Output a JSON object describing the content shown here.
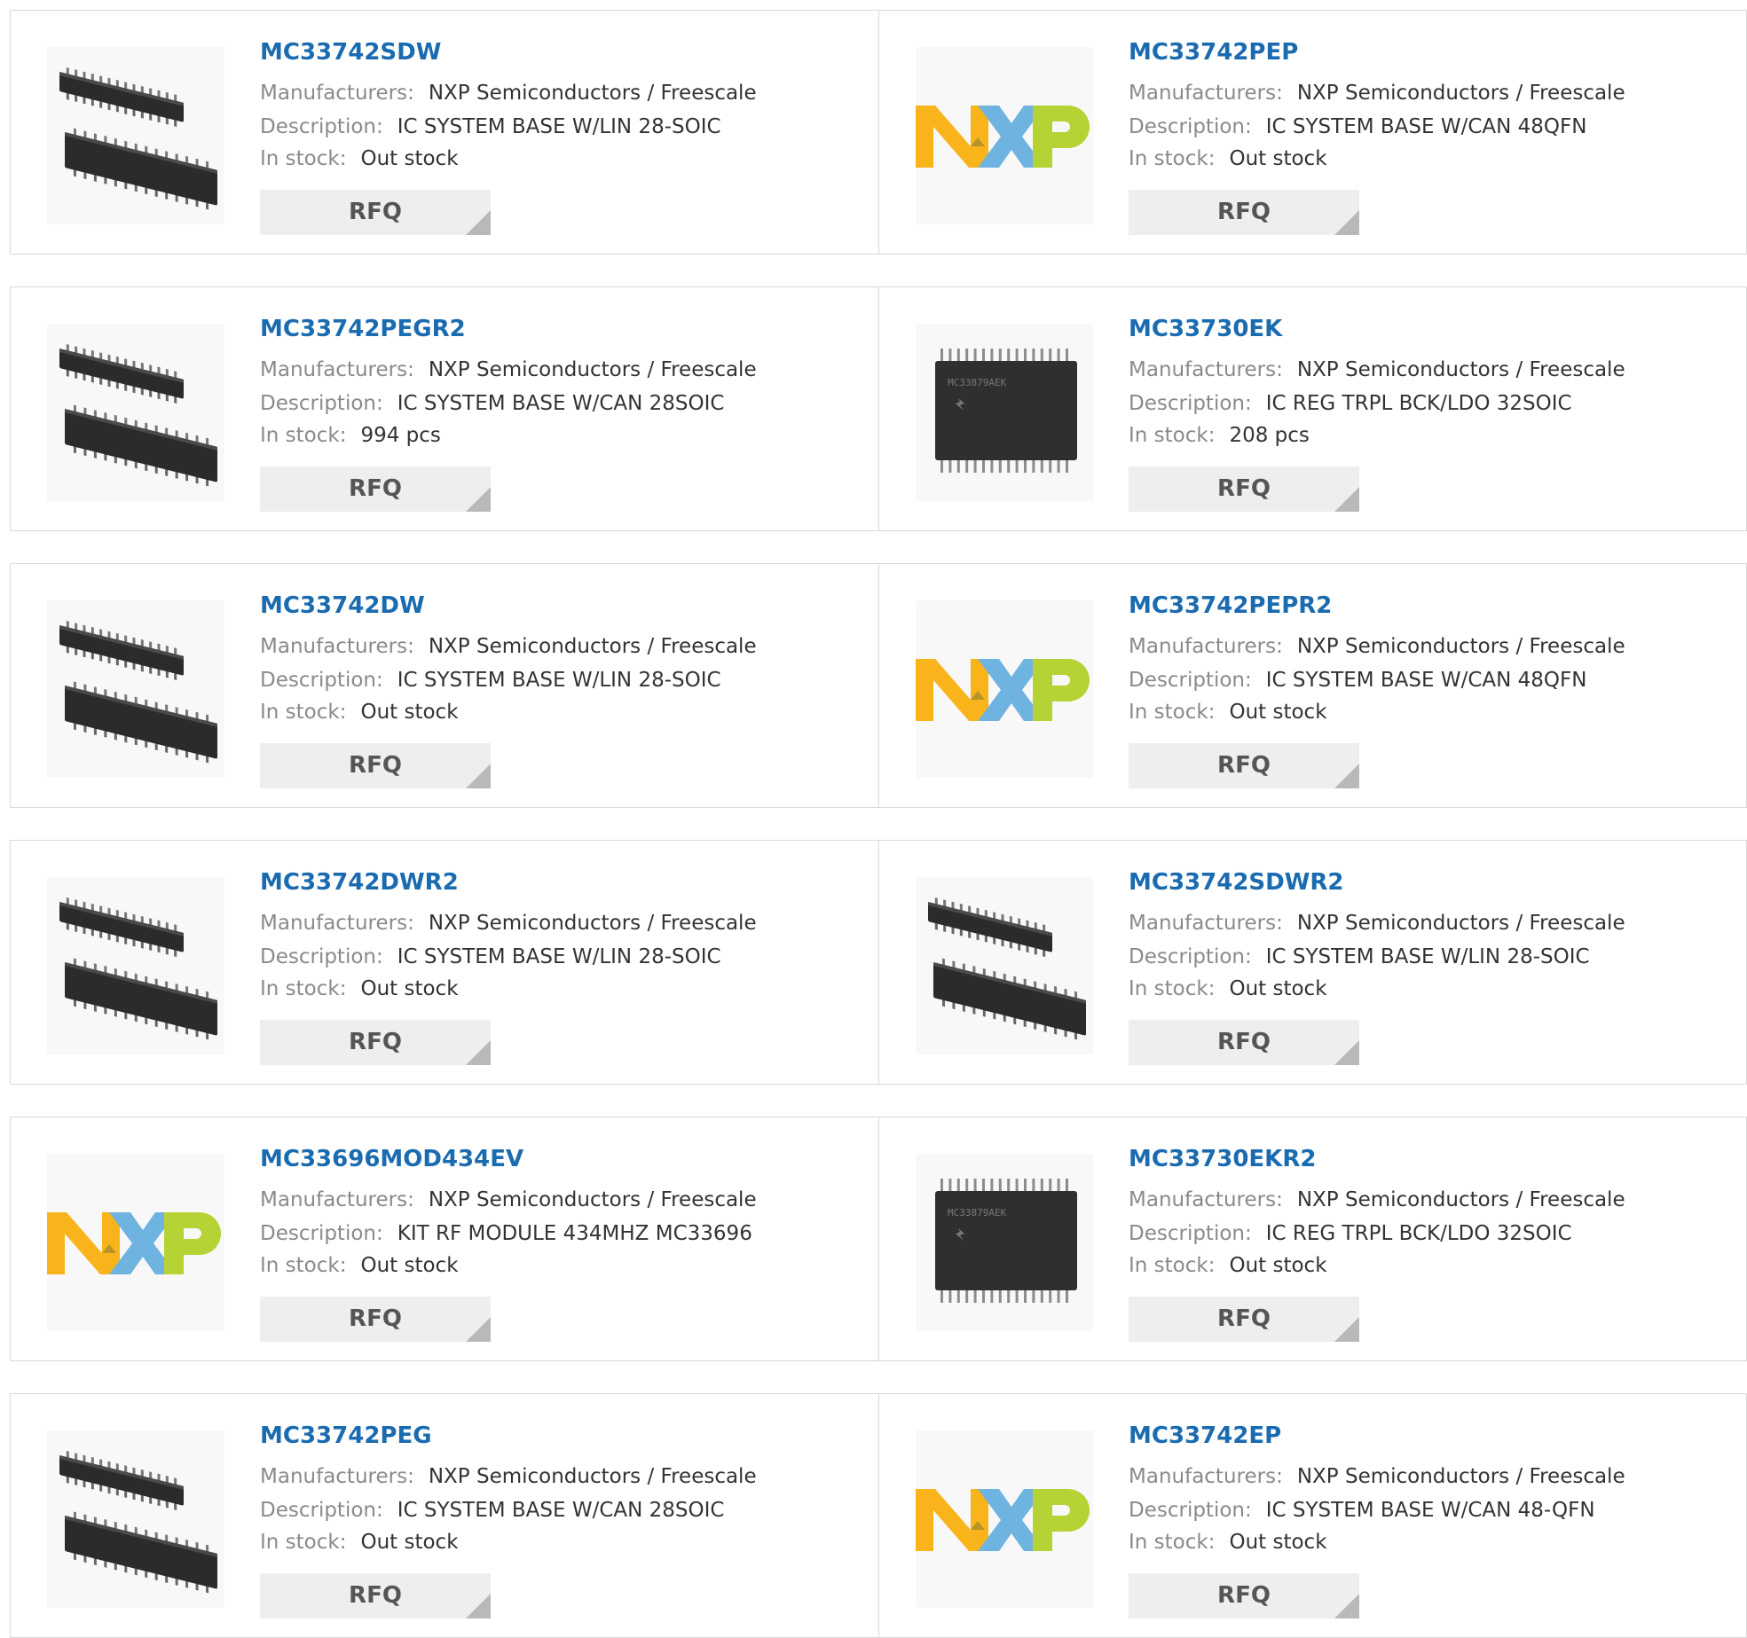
{
  "labels": {
    "manufacturers": "Manufacturers:",
    "description": "Description:",
    "in_stock": "In stock:",
    "rfq": "RFQ"
  },
  "colors": {
    "part_link": "#1a6bb0",
    "rfq_bg": "#eeeeee",
    "border": "#d9d9d9",
    "nxp_orange": "#f9b41b",
    "nxp_blue": "#6fb3e0",
    "nxp_green": "#b5d334"
  },
  "rows": [
    [
      {
        "part": "MC33742SDW",
        "image": "soic-package-pair-icon",
        "manufacturer": "NXP Semiconductors / Freescale",
        "description": "IC SYSTEM BASE W/LIN 28-SOIC",
        "stock": "Out stock"
      },
      {
        "part": "MC33742PEP",
        "image": "nxp-logo-icon",
        "manufacturer": "NXP Semiconductors / Freescale",
        "description": "IC SYSTEM BASE W/CAN 48QFN",
        "stock": "Out stock"
      }
    ],
    [
      {
        "part": "MC33742PEGR2",
        "image": "soic-package-pair-icon",
        "manufacturer": "NXP Semiconductors / Freescale",
        "description": "IC SYSTEM BASE W/CAN 28SOIC",
        "stock": "994 pcs"
      },
      {
        "part": "MC33730EK",
        "image": "chip-top-view-icon",
        "chip_marking": "MC33879AEK",
        "manufacturer": "NXP Semiconductors / Freescale",
        "description": "IC REG TRPL BCK/LDO 32SOIC",
        "stock": "208 pcs"
      }
    ],
    [
      {
        "part": "MC33742DW",
        "image": "soic-package-pair-icon",
        "manufacturer": "NXP Semiconductors / Freescale",
        "description": "IC SYSTEM BASE W/LIN 28-SOIC",
        "stock": "Out stock"
      },
      {
        "part": "MC33742PEPR2",
        "image": "nxp-logo-icon",
        "manufacturer": "NXP Semiconductors / Freescale",
        "description": "IC SYSTEM BASE W/CAN 48QFN",
        "stock": "Out stock"
      }
    ],
    [
      {
        "part": "MC33742DWR2",
        "image": "soic-package-pair-icon",
        "manufacturer": "NXP Semiconductors / Freescale",
        "description": "IC SYSTEM BASE W/LIN 28-SOIC",
        "stock": "Out stock"
      },
      {
        "part": "MC33742SDWR2",
        "image": "soic-package-pair-icon",
        "manufacturer": "NXP Semiconductors / Freescale",
        "description": "IC SYSTEM BASE W/LIN 28-SOIC",
        "stock": "Out stock"
      }
    ],
    [
      {
        "part": "MC33696MOD434EV",
        "image": "nxp-logo-icon",
        "manufacturer": "NXP Semiconductors / Freescale",
        "description": "KIT RF MODULE 434MHZ MC33696",
        "stock": "Out stock"
      },
      {
        "part": "MC33730EKR2",
        "image": "chip-top-view-icon",
        "chip_marking": "MC33879AEK",
        "manufacturer": "NXP Semiconductors / Freescale",
        "description": "IC REG TRPL BCK/LDO 32SOIC",
        "stock": "Out stock"
      }
    ],
    [
      {
        "part": "MC33742PEG",
        "image": "soic-package-pair-icon",
        "manufacturer": "NXP Semiconductors / Freescale",
        "description": "IC SYSTEM BASE W/CAN 28SOIC",
        "stock": "Out stock"
      },
      {
        "part": "MC33742EP",
        "image": "nxp-logo-icon",
        "manufacturer": "NXP Semiconductors / Freescale",
        "description": "IC SYSTEM BASE W/CAN 48-QFN",
        "stock": "Out stock"
      }
    ]
  ]
}
